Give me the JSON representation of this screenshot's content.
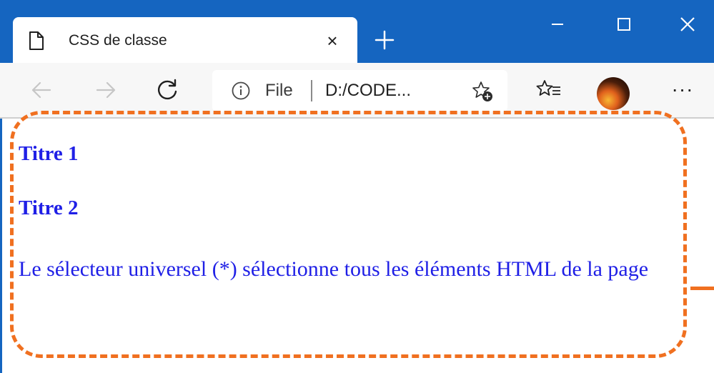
{
  "browser": {
    "tab": {
      "title": "CSS de classe",
      "close_label": "×"
    },
    "toolbar": {
      "file_label": "File",
      "url": "D:/CODE...",
      "menu_label": "···"
    }
  },
  "page": {
    "heading1": "Titre 1",
    "heading2": "Titre 2",
    "paragraph": "Le sélecteur universel (*) sélectionne tous les éléments HTML de la page"
  },
  "colors": {
    "titlebar": "#1565c0",
    "page_text": "#1f1fe6",
    "annotation": "#f07020"
  },
  "icons": {
    "tab": "document-icon",
    "new_tab": "plus-icon",
    "minimize": "minimize-icon",
    "maximize": "maximize-icon",
    "close": "close-icon",
    "back": "arrow-left-icon",
    "forward": "arrow-right-icon",
    "refresh": "refresh-icon",
    "info": "info-icon",
    "add_favorite": "star-plus-icon",
    "favorites": "favorites-list-icon",
    "profile": "avatar",
    "menu": "more-icon"
  }
}
